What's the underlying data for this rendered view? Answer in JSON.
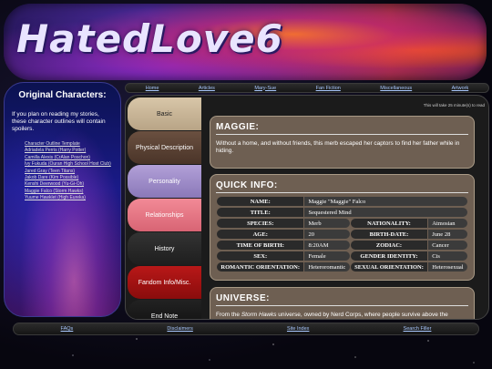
{
  "banner": {
    "title": "HatedLove6"
  },
  "sidebar": {
    "heading": "Original Characters:",
    "warning": "If you plan on reading my stories, these character outlines will contain spoilers.",
    "links": [
      "Character Outline Template",
      "Adriadela Perris (Harry Potter)",
      "Camilla Alexis (CrAlan Poschon)",
      "Ivy Fukuda (Ouran High School Host Club)",
      "Jared Gray (Teen Titans)",
      "Jakob Dare (Kim Possible)",
      "Kenshi Deerwood (Yu-Gi-Oh)",
      "Maggie Falco (Storm Hawks)",
      "Yuume Hawklet (High Eureka)"
    ]
  },
  "topnav": [
    "Home",
    "Articles",
    "Mary-Sue",
    "Fan Fiction",
    "Miscellaneous",
    "Artwork"
  ],
  "bottomnav": [
    "FAQs",
    "Disclaimers",
    "Site Index",
    "Search Filler"
  ],
  "tabs": [
    "Basic",
    "Physical Description",
    "Personality",
    "Relationships",
    "History",
    "Fandom Info/Misc.",
    "End Note"
  ],
  "content": {
    "read_time": "This will take 25 minute(s) to read",
    "maggie": {
      "heading": "MAGGIE:",
      "text": "Without a home, and without friends, this merb escaped her captors to find her father while in hiding."
    },
    "quick_info": {
      "heading": "QUICK INFO:",
      "name_label": "NAME:",
      "name_value": "Maggie \"Maggie\" Falco",
      "title_label": "TITLE:",
      "title_value": "Sequestered Mind",
      "species_label": "SPECIES:",
      "species_value": "Merb",
      "nationality_label": "NATIONALITY:",
      "nationality_value": "Atmosian",
      "age_label": "AGE:",
      "age_value": "20",
      "birthdate_label": "BIRTH-DATE:",
      "birthdate_value": "June 28",
      "birthtime_label": "TIME OF BIRTH:",
      "birthtime_value": "8:20AM",
      "zodiac_label": "ZODIAC:",
      "zodiac_value": "Cancer",
      "sex_label": "SEX:",
      "sex_value": "Female",
      "gender_label": "GENDER IDENTITY:",
      "gender_value": "Cis",
      "romantic_label": "ROMANTIC ORIENTATION:",
      "romantic_value": "Heteroromantic",
      "sexual_label": "SEXUAL ORIENTATION:",
      "sexual_value": "Heterosexual"
    },
    "universe": {
      "heading": "UNIVERSE:",
      "text_pre": "From the ",
      "text_em": "Storm Hawks",
      "text_post": " universe, owned by Nerd Corps, where people survive above the"
    }
  }
}
